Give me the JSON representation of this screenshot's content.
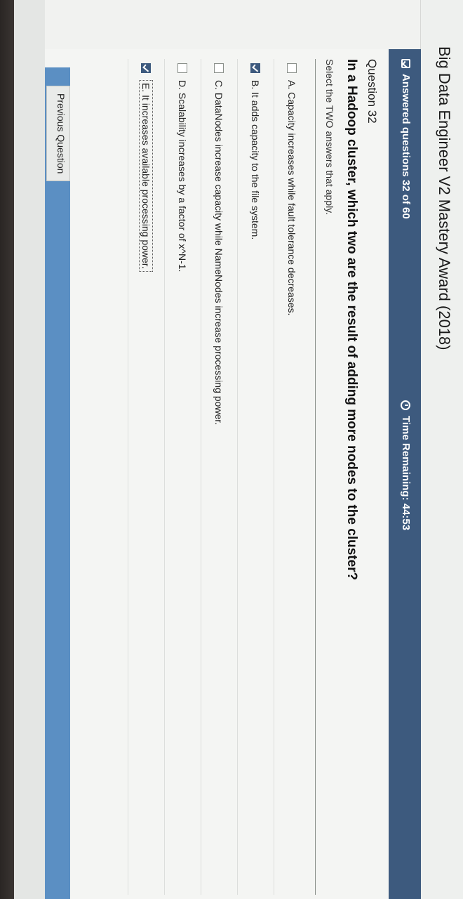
{
  "window": {
    "title": "Big Data Engineer V2 Mastery Award (2018)"
  },
  "status": {
    "answered_label": "Answered questions 32 of 60",
    "timer_label": "Time Remaining: 44:53",
    "answered_icon": "checkbox-icon",
    "timer_icon": "clock-icon"
  },
  "question": {
    "number_label": "Question 32",
    "text": "In a Hadoop cluster, which two are the result of adding more nodes to the cluster?",
    "instruction": "Select the TWO answers that apply."
  },
  "answers": [
    {
      "label": "A. Capacity increases while fault tolerance decreases.",
      "checked": false
    },
    {
      "label": "B. It adds capacity to the file system.",
      "checked": true
    },
    {
      "label": "C. DataNodes increase capacity while NameNodes increase processing power.",
      "checked": false
    },
    {
      "label": "D. Scalability increases by a factor of x^N-1.",
      "checked": false
    },
    {
      "label": "E. It increases available processing power.",
      "checked": true
    }
  ],
  "navigation": {
    "previous_label": "Previous Question"
  },
  "colors": {
    "accent": "#3d5a7e",
    "bottom_accent": "#5b8fc3"
  }
}
